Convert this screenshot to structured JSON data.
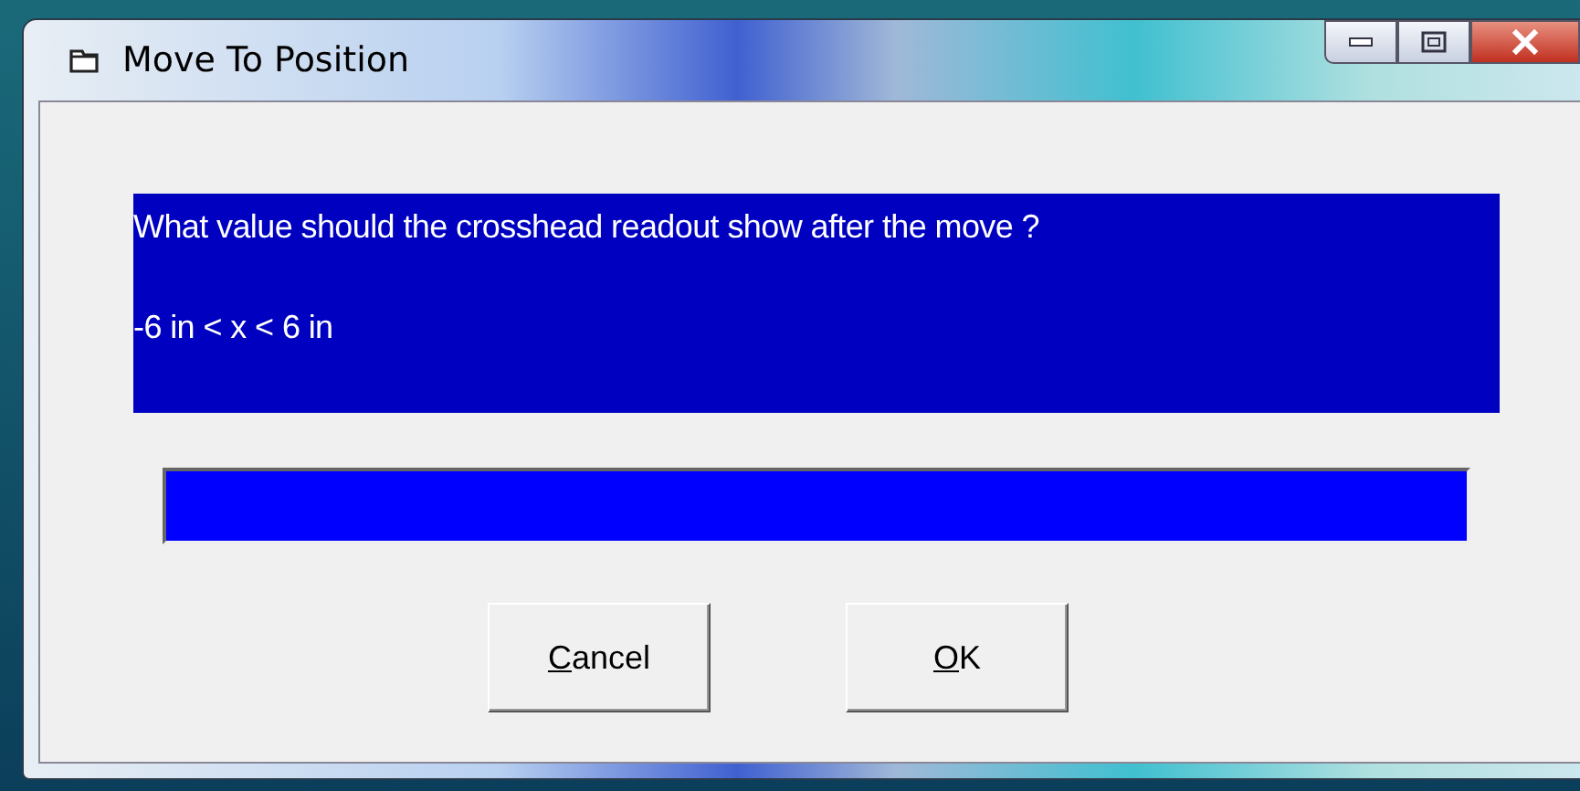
{
  "window": {
    "title": "Move To Position"
  },
  "prompt": {
    "lines": [
      "What value should the crosshead readout show after the move ?",
      "-6 in < x < 6 in"
    ]
  },
  "buttons": [
    {
      "mnemonic": "C",
      "rest": "ancel"
    },
    {
      "mnemonic": "O",
      "rest": "K"
    }
  ]
}
